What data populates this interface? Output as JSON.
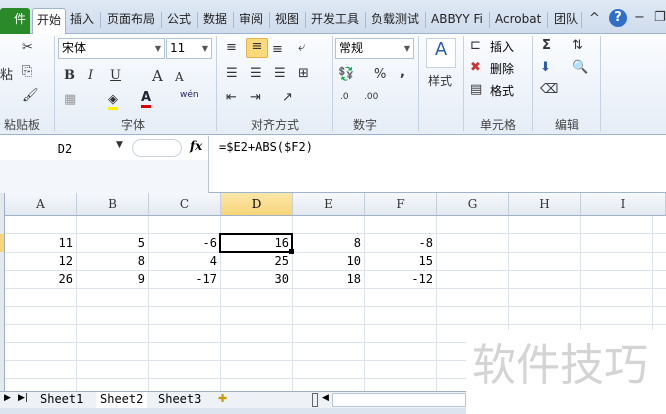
{
  "ribbon_tabs": [
    "件",
    "开始",
    "插入",
    "页面布局",
    "公式",
    "数据",
    "审阅",
    "视图",
    "开发工具",
    "负载测试",
    "ABBYY Fi",
    "Acrobat",
    "团队"
  ],
  "window_icons": {
    "collapse": "^",
    "help": "?",
    "minimize": "−",
    "restore": "❐"
  },
  "clipboard": {
    "paste": "粘",
    "label": "粘贴板"
  },
  "font": {
    "name": "宋体",
    "size": "11",
    "bold": "B",
    "italic": "I",
    "underline": "U",
    "grow": "A",
    "shrink": "A",
    "phonetic": "wén",
    "label": "字体"
  },
  "alignment": {
    "label": "对齐方式"
  },
  "number": {
    "format": "常规",
    "percent": "%",
    "comma": ",",
    "label": "数字"
  },
  "styles": {
    "label": "样式"
  },
  "cells": {
    "insert": "插入",
    "delete": "删除",
    "format": "格式",
    "label": "单元格"
  },
  "editing": {
    "sum": "Σ",
    "label": "编辑"
  },
  "formula_bar": {
    "name_box": "D2",
    "fx": "fx",
    "formula": "=$E2+ABS($F2)"
  },
  "columns": [
    "A",
    "B",
    "C",
    "D",
    "E",
    "F",
    "G",
    "H",
    "I"
  ],
  "rows": [
    [
      "11",
      "5",
      "-6",
      "16",
      "8",
      "-8"
    ],
    [
      "12",
      "8",
      "4",
      "25",
      "10",
      "15"
    ],
    [
      "26",
      "9",
      "-17",
      "30",
      "18",
      "-12"
    ]
  ],
  "sheets": [
    "Sheet1",
    "Sheet2",
    "Sheet3"
  ],
  "watermark": "软件技巧",
  "colors": {
    "accent": "#f8d47a",
    "file_tab": "#2a8a2a"
  }
}
